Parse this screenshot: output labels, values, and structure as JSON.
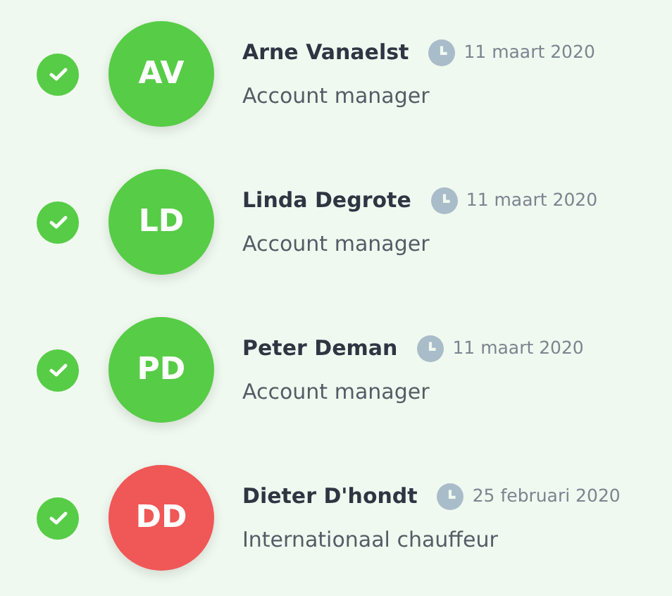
{
  "people": [
    {
      "initials": "AV",
      "name": "Arne Vanaelst",
      "date": "11 maart 2020",
      "role": "Account manager",
      "color": "#57cc47",
      "checked": true
    },
    {
      "initials": "LD",
      "name": "Linda Degrote",
      "date": "11 maart 2020",
      "role": "Account manager",
      "color": "#57cc47",
      "checked": true
    },
    {
      "initials": "PD",
      "name": "Peter Deman",
      "date": "11 maart 2020",
      "role": "Account manager",
      "color": "#57cc47",
      "checked": true
    },
    {
      "initials": "DD",
      "name": "Dieter D'hondt",
      "date": "25 februari 2020",
      "role": "Internationaal chauffeur",
      "color": "#f05757",
      "checked": true
    }
  ]
}
